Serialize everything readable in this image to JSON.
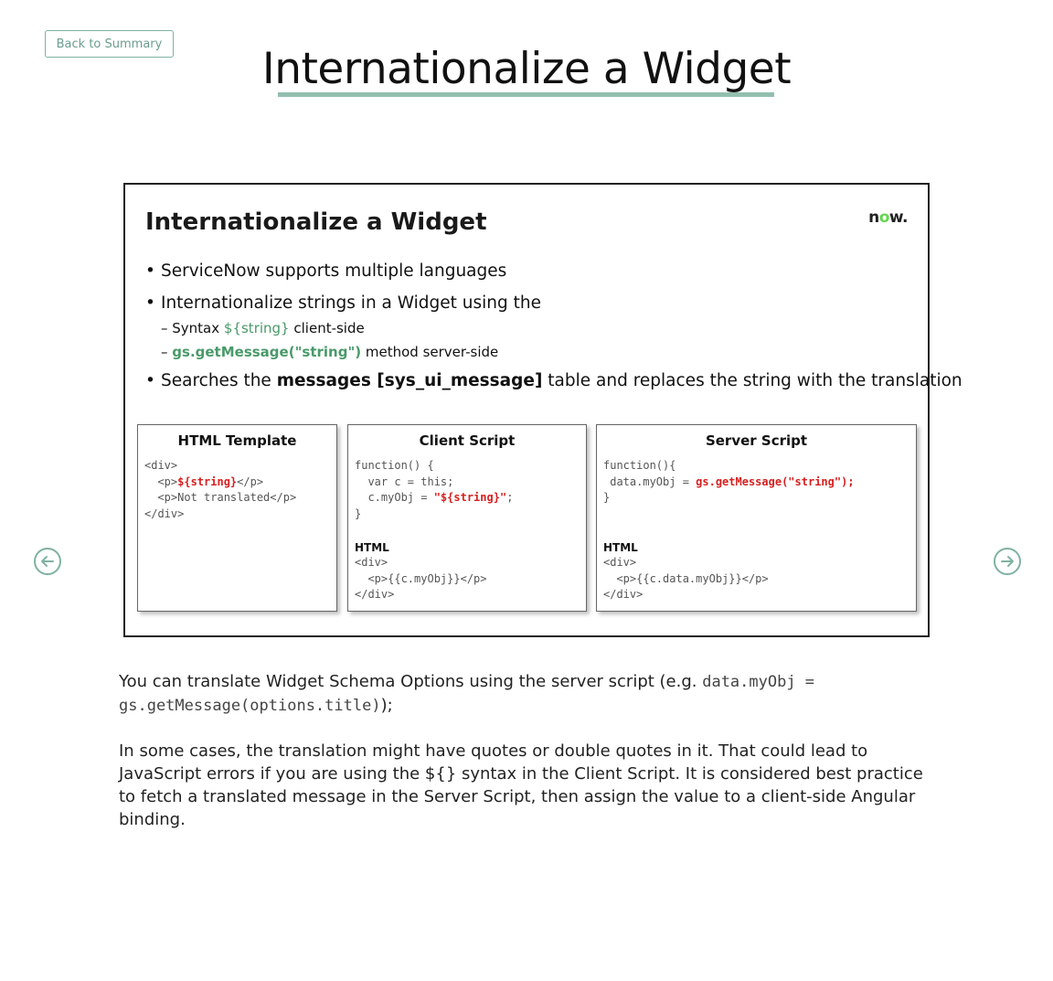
{
  "nav": {
    "back_label": "Back to Summary"
  },
  "page": {
    "title": "Internationalize a Widget"
  },
  "slide": {
    "title": "Internationalize a Widget",
    "logo": {
      "pre": "n",
      "o": "o",
      "post": "w."
    },
    "bullets": [
      {
        "text": "ServiceNow supports multiple languages"
      },
      {
        "text": "Internationalize strings in a Widget using the"
      },
      {
        "prefix": "Searches the ",
        "bold": "messages [sys_ui_message]",
        "suffix": " table and replaces the string with the translation"
      }
    ],
    "sub_bullets": [
      {
        "prefix": "– Syntax ",
        "highlight": "${string}",
        "suffix": " client-side"
      },
      {
        "prefix": "– ",
        "highlight": "gs.getMessage(\"string\")",
        "suffix": " method server-side"
      }
    ],
    "boxes": [
      {
        "header": "HTML Template",
        "lines": [
          "<div>",
          "  <p>",
          "${string}",
          "</p>",
          "  <p>Not translated</p>",
          "</div>"
        ]
      },
      {
        "header": "Client Script",
        "code": [
          "function() {",
          "  var c = this;",
          "  c.myObj = ",
          "\"${string}\"",
          ";",
          "}"
        ],
        "html_label": "HTML",
        "html": [
          "<div>",
          "  <p>{{c.myObj}}</p>",
          "</div>"
        ]
      },
      {
        "header": "Server Script",
        "code": [
          "function(){",
          " data.myObj = ",
          "gs.getMessage(\"string\");",
          "}"
        ],
        "html_label": "HTML",
        "html": [
          "<div>",
          "  <p>{{c.data.myObj}}</p>",
          "</div>"
        ]
      }
    ]
  },
  "description": {
    "p1_prefix": "You can translate Widget Schema Options using the server script (e.g. ",
    "p1_code1": "data.myObj =",
    "p1_code2": "gs.getMessage(options.title)",
    "p1_suffix": ");",
    "p2": "In some cases, the translation might have quotes or double quotes in it. That could lead to JavaScript errors if you are using the ${} syntax in the Client Script. It is considered best practice to fetch a translated message in the Server Script, then assign the value to a client-side Angular binding."
  }
}
